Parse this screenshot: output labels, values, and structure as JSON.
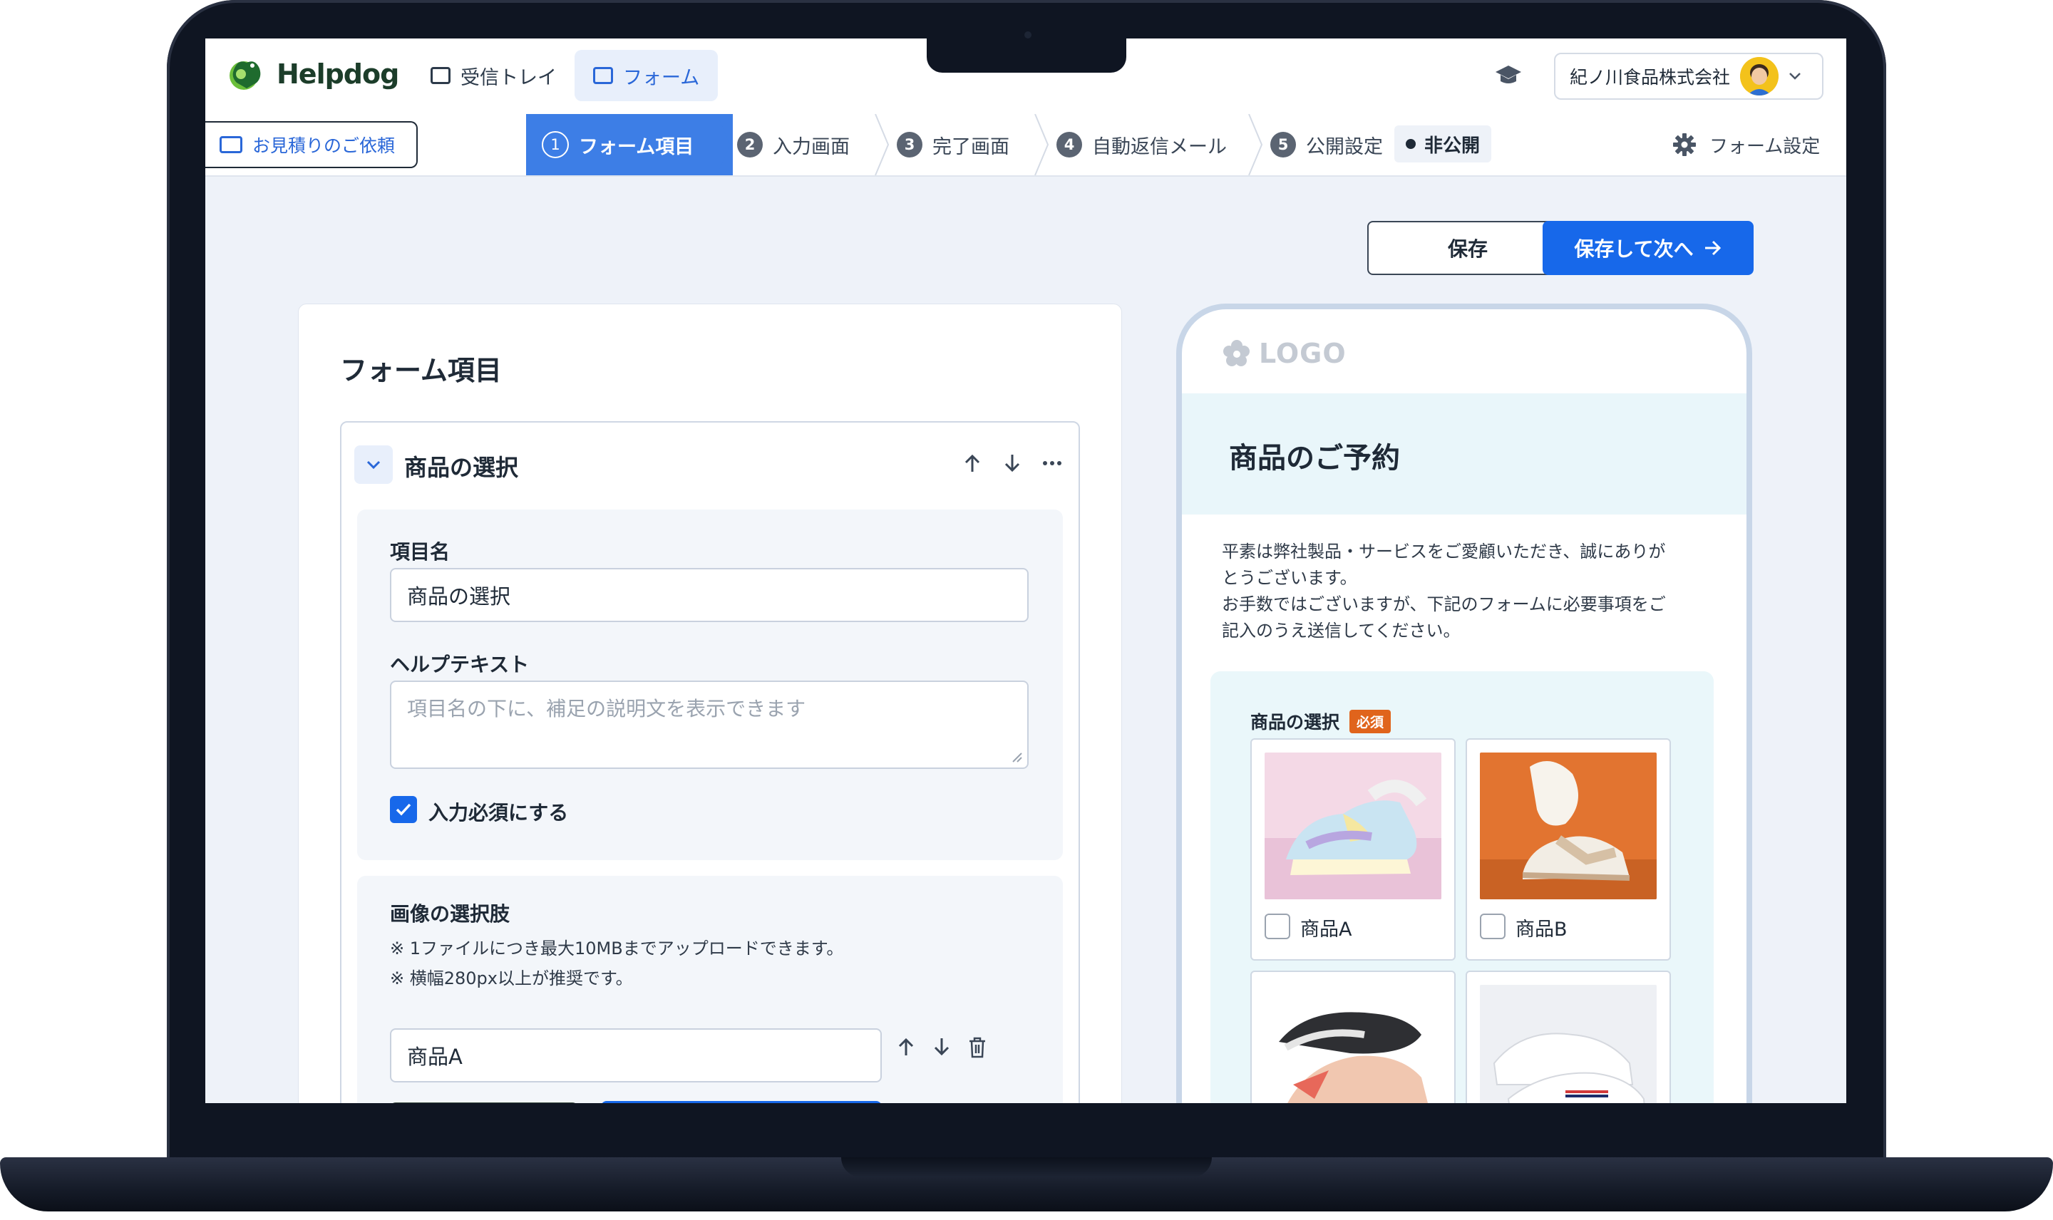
{
  "app": {
    "name": "Helpdog"
  },
  "nav": {
    "tabs": [
      {
        "label": "受信トレイ",
        "icon": "inbox-icon"
      },
      {
        "label": "フォーム",
        "icon": "form-icon"
      }
    ],
    "company": "紀ノ川食品株式会社"
  },
  "stepbar": {
    "form_name": "お見積りのご依頼",
    "steps": [
      {
        "num": "1",
        "label": "フォーム項目"
      },
      {
        "num": "2",
        "label": "入力画面"
      },
      {
        "num": "3",
        "label": "完了画面"
      },
      {
        "num": "4",
        "label": "自動返信メール"
      },
      {
        "num": "5",
        "label": "公開設定"
      }
    ],
    "status": "非公開",
    "settings_label": "フォーム設定"
  },
  "actions": {
    "save": "保存",
    "save_next": "保存して次へ"
  },
  "editor": {
    "title": "フォーム項目",
    "field": {
      "title": "商品の選択",
      "name_label": "項目名",
      "name_value": "商品の選択",
      "help_label": "ヘルプテキスト",
      "help_placeholder": "項目名の下に、補足の説明文を表示できます",
      "required_label": "入力必須にする",
      "required_checked": true,
      "image_choices_label": "画像の選択肢",
      "notes": [
        "※ 1ファイルにつき最大10MBまでアップロードできます。",
        "※ 横幅280px以上が推奨です。"
      ],
      "choice_a_value": "商品A"
    }
  },
  "preview": {
    "logo": "LOGO",
    "title": "商品のご予約",
    "description": [
      "平素は弊社製品・サービスをご愛顧いただき、誠にありが",
      "とうございます。",
      "お手数ではございますが、下記のフォームに必要事項をご",
      "記入のうえ送信してください。"
    ],
    "field_label": "商品の選択",
    "required_badge": "必須",
    "choices": [
      {
        "label": "商品A",
        "image": "pastel-sneaker-photo"
      },
      {
        "label": "商品B",
        "image": "white-sneaker-orange-bg-photo"
      },
      {
        "label": "",
        "image": "running-shoe-photo"
      },
      {
        "label": "",
        "image": "white-sneaker-photo"
      }
    ]
  },
  "colors": {
    "primary": "#1768ea",
    "step_active": "#3d7ee6",
    "brand_green": "#2e8a3a",
    "required": "#e0641c"
  }
}
